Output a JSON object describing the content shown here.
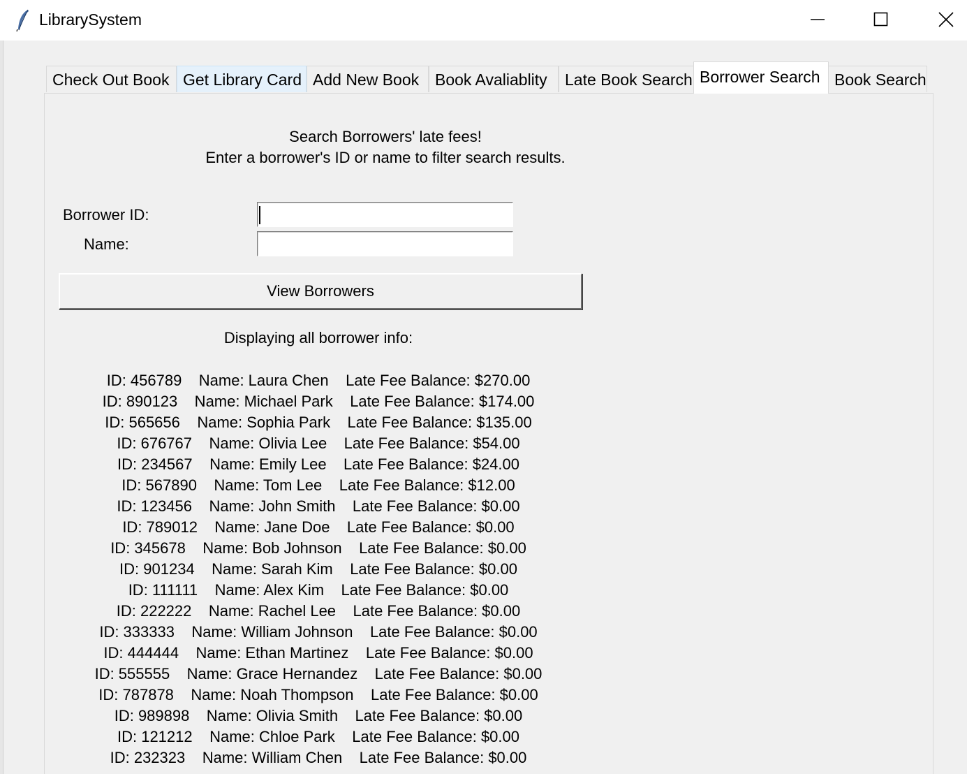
{
  "window": {
    "title": "LibrarySystem",
    "minimize_icon": "minimize-icon",
    "maximize_icon": "maximize-icon",
    "close_icon": "close-icon"
  },
  "tabs": [
    {
      "label": "Check Out Book"
    },
    {
      "label": "Get Library Card"
    },
    {
      "label": "Add New Book"
    },
    {
      "label": "Book Avaliablity"
    },
    {
      "label": "Late Book Search"
    },
    {
      "label": "Borrower Search"
    },
    {
      "label": "Book Search"
    }
  ],
  "active_tab": "Borrower Search",
  "header": {
    "line1": "Search Borrowers' late fees!",
    "line2": "Enter a borrower's ID or name to filter search results."
  },
  "form": {
    "borrower_id_label": "Borrower ID:",
    "borrower_id_value": "",
    "name_label": "Name:",
    "name_value": "",
    "view_button": "View Borrowers"
  },
  "results": {
    "title": "Displaying all borrower info:",
    "rows": [
      "ID: 456789    Name: Laura Chen    Late Fee Balance: $270.00",
      "ID: 890123    Name: Michael Park    Late Fee Balance: $174.00",
      "ID: 565656    Name: Sophia Park    Late Fee Balance: $135.00",
      "ID: 676767    Name: Olivia Lee    Late Fee Balance: $54.00",
      "ID: 234567    Name: Emily Lee    Late Fee Balance: $24.00",
      "ID: 567890    Name: Tom Lee    Late Fee Balance: $12.00",
      "ID: 123456    Name: John Smith    Late Fee Balance: $0.00",
      "ID: 789012    Name: Jane Doe    Late Fee Balance: $0.00",
      "ID: 345678    Name: Bob Johnson    Late Fee Balance: $0.00",
      "ID: 901234    Name: Sarah Kim    Late Fee Balance: $0.00",
      "ID: 111111    Name: Alex Kim    Late Fee Balance: $0.00",
      "ID: 222222    Name: Rachel Lee    Late Fee Balance: $0.00",
      "ID: 333333    Name: William Johnson    Late Fee Balance: $0.00",
      "ID: 444444    Name: Ethan Martinez    Late Fee Balance: $0.00",
      "ID: 555555    Name: Grace Hernandez    Late Fee Balance: $0.00",
      "ID: 787878    Name: Noah Thompson    Late Fee Balance: $0.00",
      "ID: 989898    Name: Olivia Smith    Late Fee Balance: $0.00",
      "ID: 121212    Name: Chloe Park    Late Fee Balance: $0.00",
      "ID: 232323    Name: William Chen    Late Fee Balance: $0.00"
    ]
  }
}
